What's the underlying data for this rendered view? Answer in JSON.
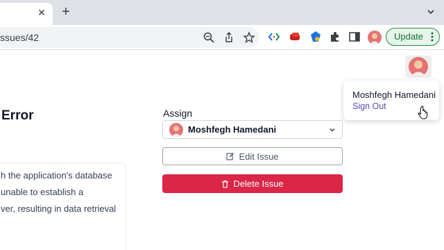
{
  "browser": {
    "tab_close_glyph": "✕",
    "new_tab_glyph": "+",
    "url": "ssues/42",
    "update_label": "Update",
    "icons": [
      "zoom-icon",
      "share-icon",
      "bookmark-star-icon",
      "code-extension-icon",
      "red-extension-icon",
      "blue-extension-icon",
      "puzzle-extensions-icon",
      "side-panel-icon",
      "profile-avatar-icon",
      "more-icon"
    ]
  },
  "issue": {
    "title_partial": "Error",
    "description_lines": [
      "h the application's database",
      "unable to establish a",
      "ver, resulting in data retrieval"
    ]
  },
  "assign": {
    "label": "Assign",
    "selected": "Moshfegh Hamedani"
  },
  "actions": {
    "edit_label": "Edit Issue",
    "delete_label": "Delete Issue"
  },
  "user_menu": {
    "name": "Moshfegh Hamedani",
    "sign_out": "Sign Out"
  },
  "colors": {
    "delete": "#dc2647",
    "sign_out_link": "#5b4db3",
    "update_border": "#1e8e3e",
    "update_bg": "#e6f4ea"
  }
}
